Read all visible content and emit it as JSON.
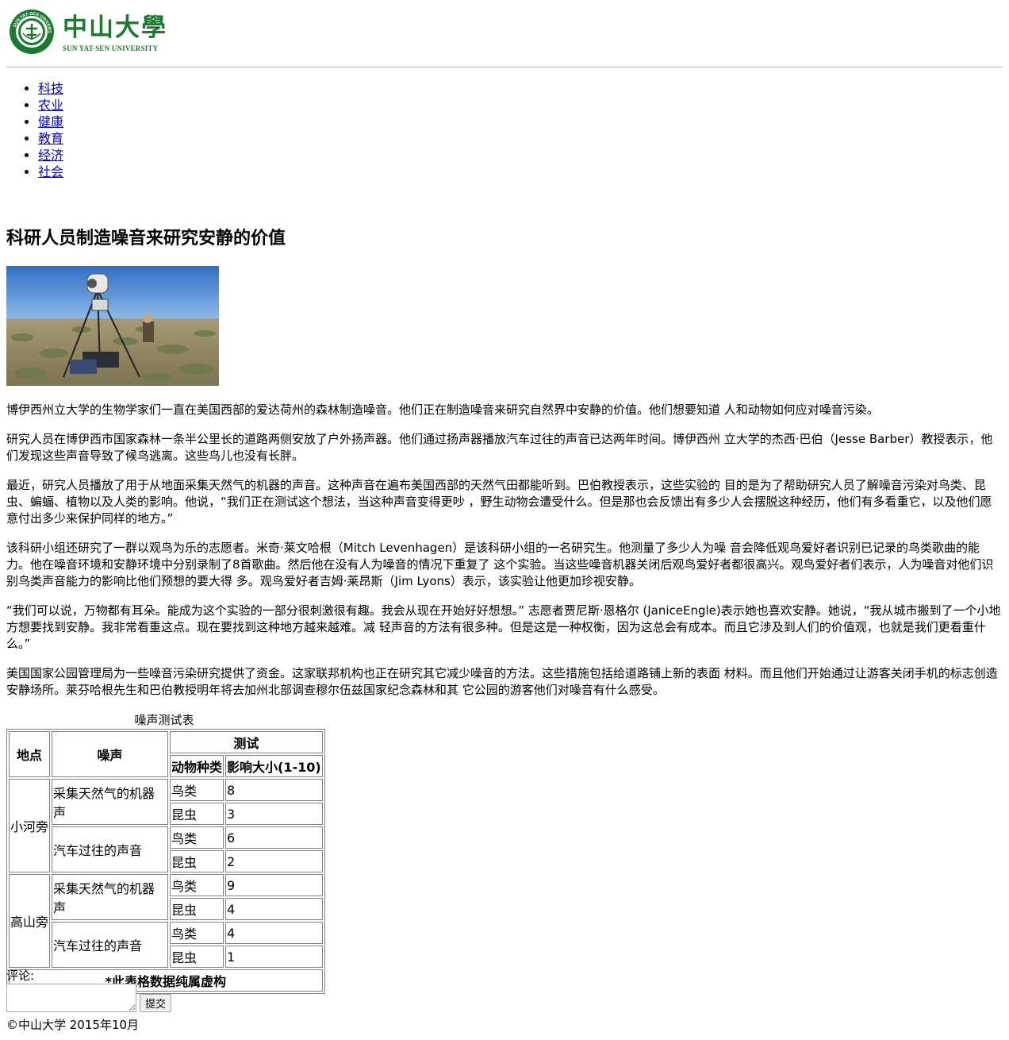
{
  "logo": {
    "name_cn": "中山大學",
    "name_en": "SUN YAT-SEN UNIVERSITY",
    "seal_text": "SUN YAT-SEN UNIVERSITY",
    "color": "#1a7a2e"
  },
  "nav": [
    "科技",
    "农业",
    "健康",
    "教育",
    "经济",
    "社会"
  ],
  "article": {
    "title": "科研人员制造噪音来研究安静的价值",
    "paragraphs": [
      "博伊西州立大学的生物学家们一直在美国西部的爱达荷州的森林制造噪音。他们正在制造噪音来研究自然界中安静的价值。他们想要知道 人和动物如何应对噪音污染。",
      "研究人员在博伊西市国家森林一条半公里长的道路两侧安放了户外扬声器。他们通过扬声器播放汽车过往的声音已达两年时间。博伊西州 立大学的杰西·巴伯（Jesse Barber）教授表示，他们发现这些声音导致了候鸟逃离。这些鸟儿也没有长胖。",
      "最近，研究人员播放了用于从地面采集天然气的机器的声音。这种声音在遍布美国西部的天然气田都能听到。巴伯教授表示，这些实验的 目的是为了帮助研究人员了解噪音污染对鸟类、昆虫、蝙蝠、植物以及人类的影响。他说，“我们正在测试这个想法，当这种声音变得更吵 ，野生动物会遭受什么。但是那也会反馈出有多少人会摆脱这种经历，他们有多看重它，以及他们愿意付出多少来保护同样的地方。”",
      "该科研小组还研究了一群以观鸟为乐的志愿者。米奇·莱文哈根（Mitch Levenhagen）是该科研小组的一名研究生。他测量了多少人为噪 音会降低观鸟爱好者识别已记录的鸟类歌曲的能力。他在噪音环境和安静环境中分别录制了8首歌曲。然后他在没有人为噪音的情况下重复了 这个实验。当这些噪音机器关闭后观鸟爱好者都很高兴。观鸟爱好者们表示，人为噪音对他们识别鸟类声音能力的影响比他们预想的要大得 多。观鸟爱好者吉姆·莱昂斯（Jim Lyons）表示，该实验让他更加珍视安静。",
      "“我们可以说，万物都有耳朵。能成为这个实验的一部分很刺激很有趣。我会从现在开始好好想想。” 志愿者贾尼斯·恩格尔 (JaniceEngle)表示她也喜欢安静。她说，“我从城市搬到了一个小地方想要找到安静。我非常看重这点。现在要找到这种地方越来越难。减 轻声音的方法有很多种。但是这是一种权衡，因为这总会有成本。而且它涉及到人们的价值观，也就是我们更看重什么。”",
      "美国国家公园管理局为一些噪音污染研究提供了资金。这家联邦机构也正在研究其它减少噪音的方法。这些措施包括给道路铺上新的表面 材料。而且他们开始通过让游客关闭手机的标志创造安静场所。莱芬哈根先生和巴伯教授明年将去加州北部调查穆尔伍兹国家纪念森林和其 它公园的游客他们对噪音有什么感受。"
    ]
  },
  "table": {
    "caption": "噪声测试表",
    "headers": {
      "location": "地点",
      "noise": "噪声",
      "test": "测试",
      "species": "动物种类",
      "impact": "影响大小(1-10)"
    },
    "locations": [
      {
        "name": "小河旁",
        "noises": [
          {
            "name": "采集天然气的机器声",
            "rows": [
              {
                "species": "鸟类",
                "impact": "8"
              },
              {
                "species": "昆虫",
                "impact": "3"
              }
            ]
          },
          {
            "name": "汽车过往的声音",
            "rows": [
              {
                "species": "鸟类",
                "impact": "6"
              },
              {
                "species": "昆虫",
                "impact": "2"
              }
            ]
          }
        ]
      },
      {
        "name": "高山旁",
        "noises": [
          {
            "name": "采集天然气的机器声",
            "rows": [
              {
                "species": "鸟类",
                "impact": "9"
              },
              {
                "species": "昆虫",
                "impact": "4"
              }
            ]
          },
          {
            "name": "汽车过往的声音",
            "rows": [
              {
                "species": "鸟类",
                "impact": "4"
              },
              {
                "species": "昆虫",
                "impact": "1"
              }
            ]
          }
        ]
      }
    ],
    "footnote": "*此表格数据纯属虚构"
  },
  "comment": {
    "label": "评论:",
    "value": "",
    "submit_label": "提交"
  },
  "footer": {
    "copyright": "©中山大学 2015年10月"
  }
}
